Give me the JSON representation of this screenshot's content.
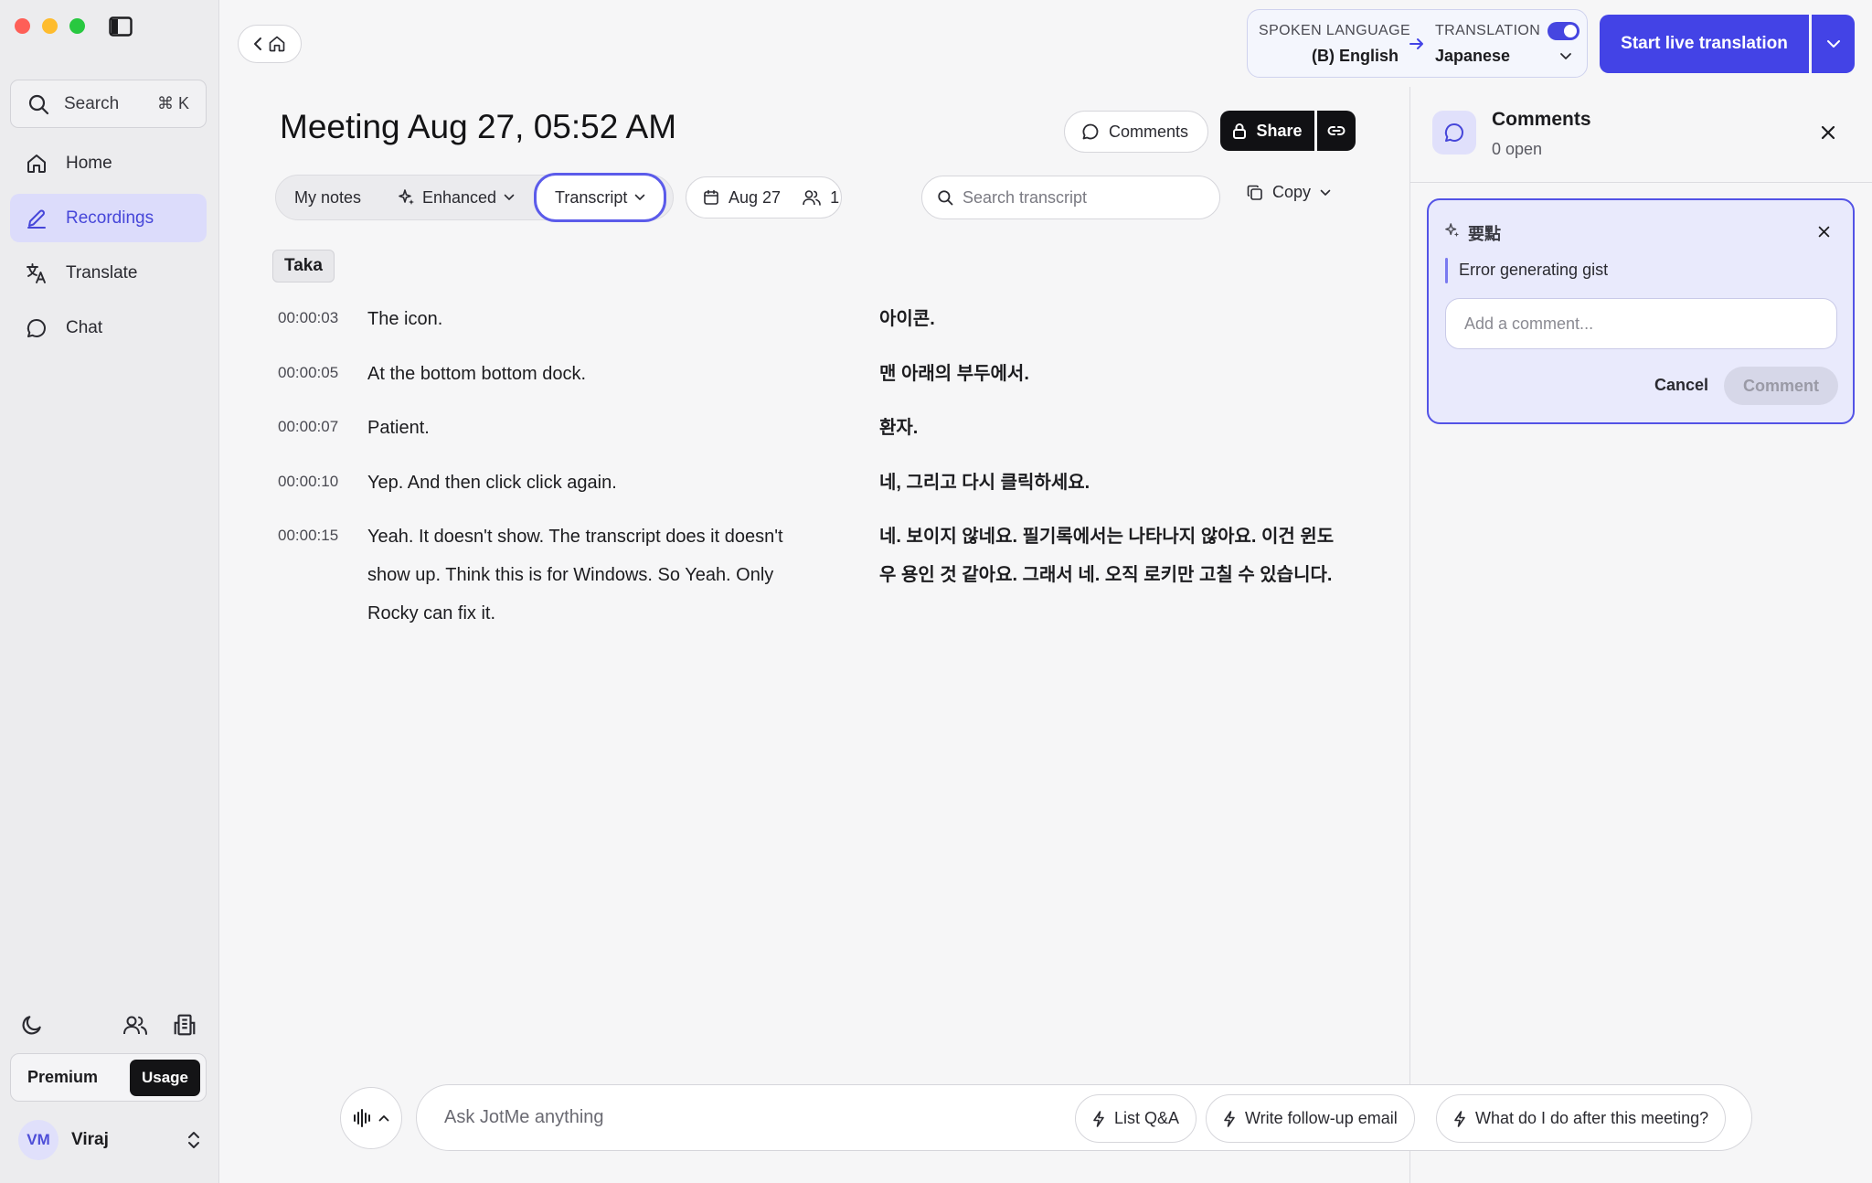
{
  "sidebar": {
    "search_label": "Search",
    "search_shortcut": "⌘ K",
    "items": [
      {
        "label": "Home",
        "icon": "home-icon"
      },
      {
        "label": "Recordings",
        "icon": "pen-icon",
        "active": true
      },
      {
        "label": "Translate",
        "icon": "translate-icon"
      },
      {
        "label": "Chat",
        "icon": "chat-icon"
      }
    ],
    "plan_label": "Premium",
    "usage_label": "Usage",
    "user_initials": "VM",
    "user_name": "Viraj"
  },
  "topbar": {
    "spoken_language_label": "SPOKEN LANGUAGE",
    "spoken_language_value": "(B) English",
    "translation_label": "TRANSLATION",
    "translation_value": "Japanese",
    "translation_enabled": true,
    "start_button": "Start live translation"
  },
  "meeting": {
    "title": "Meeting Aug 27, 05:52 AM",
    "comments_button": "Comments",
    "share_button": "Share",
    "tabs": [
      {
        "label": "My notes"
      },
      {
        "label": "Enhanced"
      },
      {
        "label": "Transcript",
        "active": true
      }
    ],
    "date_label": "Aug 27",
    "participants_count": "1",
    "search_placeholder": "Search transcript",
    "copy_label": "Copy",
    "speaker": "Taka",
    "rows": [
      {
        "time": "00:00:03",
        "source": "The icon.",
        "translation": "아이콘."
      },
      {
        "time": "00:00:05",
        "source": "At the bottom bottom dock.",
        "translation": "맨 아래의 부두에서."
      },
      {
        "time": "00:00:07",
        "source": "Patient.",
        "translation": "환자."
      },
      {
        "time": "00:00:10",
        "source": "Yep. And then click click again.",
        "translation": "네, 그리고 다시 클릭하세요."
      },
      {
        "time": "00:00:15",
        "source": "Yeah. It doesn't show. The transcript does it doesn't show up. Think this is for Windows. So Yeah. Only Rocky can fix it.",
        "translation": "네. 보이지 않네요. 필기록에서는 나타나지 않아요. 이건 윈도우 용인 것 같아요. 그래서 네. 오직 로키만 고칠 수 있습니다."
      }
    ]
  },
  "comments_panel": {
    "title": "Comments",
    "subtitle": "0 open",
    "card_title": "要點",
    "card_message": "Error generating gist",
    "input_placeholder": "Add a comment...",
    "cancel_label": "Cancel",
    "comment_label": "Comment"
  },
  "ask": {
    "placeholder": "Ask JotMe anything",
    "chips": [
      "List Q&A",
      "Write follow-up email",
      "What do I do after this meeting?"
    ]
  },
  "colors": {
    "accent": "#4343e6",
    "active_nav_bg": "#dcdcfb",
    "card_bg": "#e9eafc"
  }
}
